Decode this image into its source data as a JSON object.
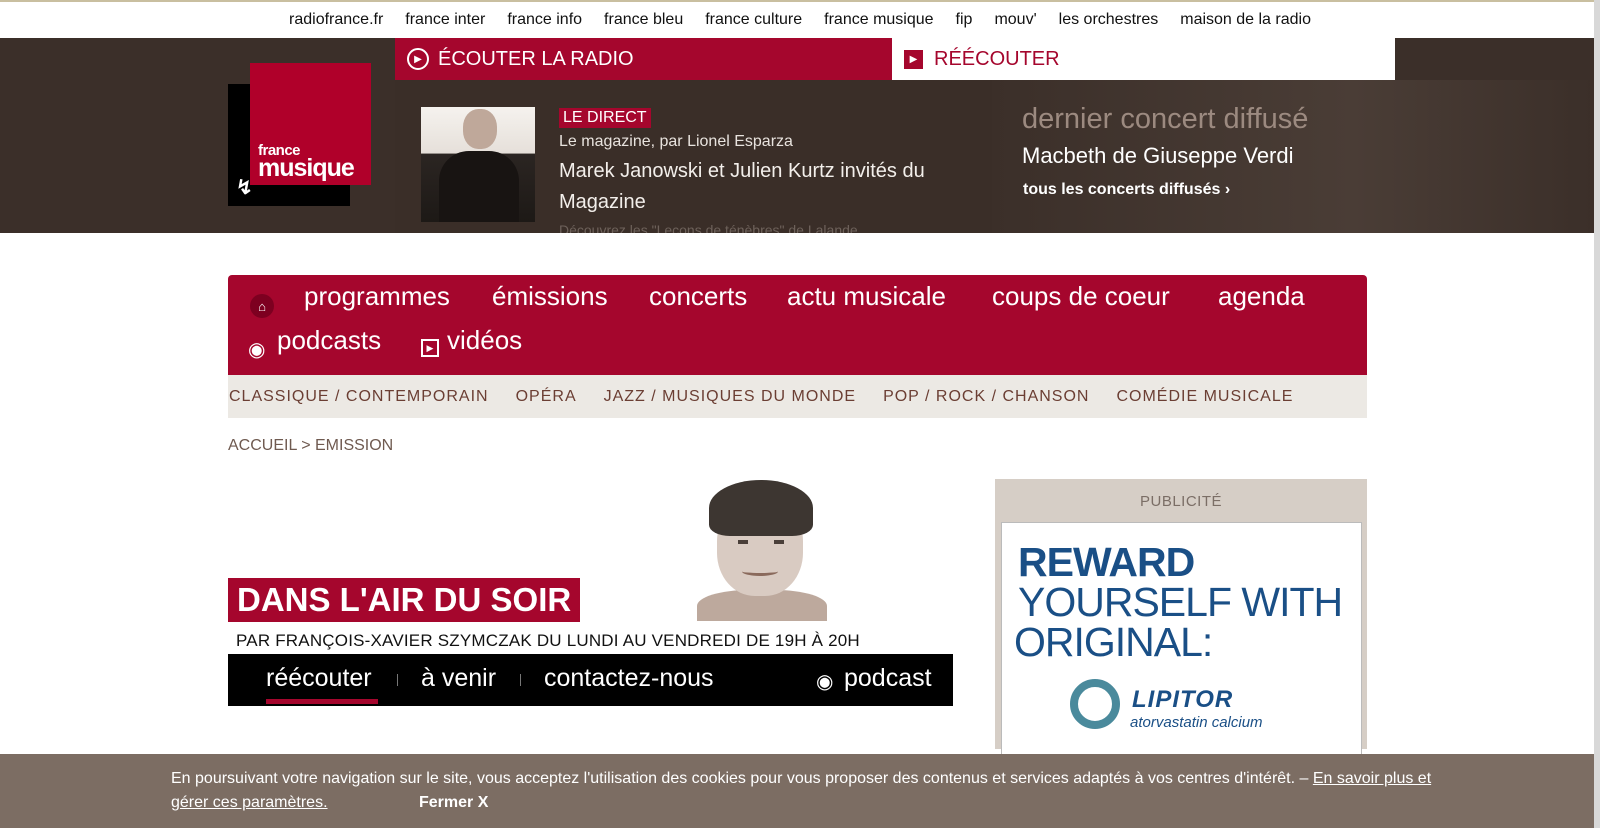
{
  "network_bar": {
    "links": [
      "radiofrance.fr",
      "france inter",
      "france info",
      "france bleu",
      "france culture",
      "france musique",
      "fip",
      "mouv'",
      "les orchestres",
      "maison de la radio"
    ]
  },
  "logo": {
    "line1": "france",
    "line2": "musique"
  },
  "header": {
    "listen_label": "ÉCOUTER LA RADIO",
    "replay_label": "RÉÉCOUTER",
    "live": {
      "badge": "LE DIRECT",
      "show": "Le magazine, par Lionel Esparza",
      "title": "Marek Janowski et Julien Kurtz invités du Magazine",
      "cut_text": "Découvrez les \"Leçons de ténèbres\" de Lalande"
    },
    "concert": {
      "heading": "dernier concert diffusé",
      "name": "Macbeth de Giuseppe Verdi",
      "all_link": "tous les concerts diffusés ›"
    }
  },
  "main_nav": {
    "home_icon": "home-icon",
    "row1": [
      "programmes",
      "émissions",
      "concerts",
      "actu musicale",
      "coups de coeur",
      "agenda"
    ],
    "podcasts": "podcasts",
    "videos": "vidéos"
  },
  "genres": [
    "CLASSIQUE / CONTEMPORAIN",
    "OPÉRA",
    "JAZZ / MUSIQUES DU MONDE",
    "POP / ROCK / CHANSON",
    "COMÉDIE MUSICALE"
  ],
  "breadcrumb": {
    "home": "ACCUEIL",
    "sep": " > ",
    "current": "EMISSION"
  },
  "show": {
    "title": "DANS L'AIR DU SOIR",
    "meta": "PAR FRANÇOIS-XAVIER SZYMCZAK DU LUNDI AU VENDREDI DE 19H À 20H",
    "tabs": {
      "replay": "réécouter",
      "upcoming": "à venir",
      "contact": "contactez-nous",
      "podcast": "podcast"
    }
  },
  "ad": {
    "label": "PUBLICITÉ",
    "line1": "REWARD",
    "line2": "YOURSELF WITH",
    "line3": "ORIGINAL:",
    "brand": "LIPITOR",
    "sub": "atorvastatin calcium"
  },
  "cookie": {
    "text": "En poursuivant votre navigation sur le site, vous acceptez l'utilisation des cookies pour vous proposer des contenus et services adaptés à vos centres d'intérêt. – ",
    "link": "En savoir plus et gérer ces paramètres.",
    "close": "Fermer X"
  },
  "colors": {
    "brand_red": "#a5062d",
    "header_brown": "#3b2f29",
    "cookie_bg": "#7c6d63",
    "genre_text": "#6b3e33"
  }
}
